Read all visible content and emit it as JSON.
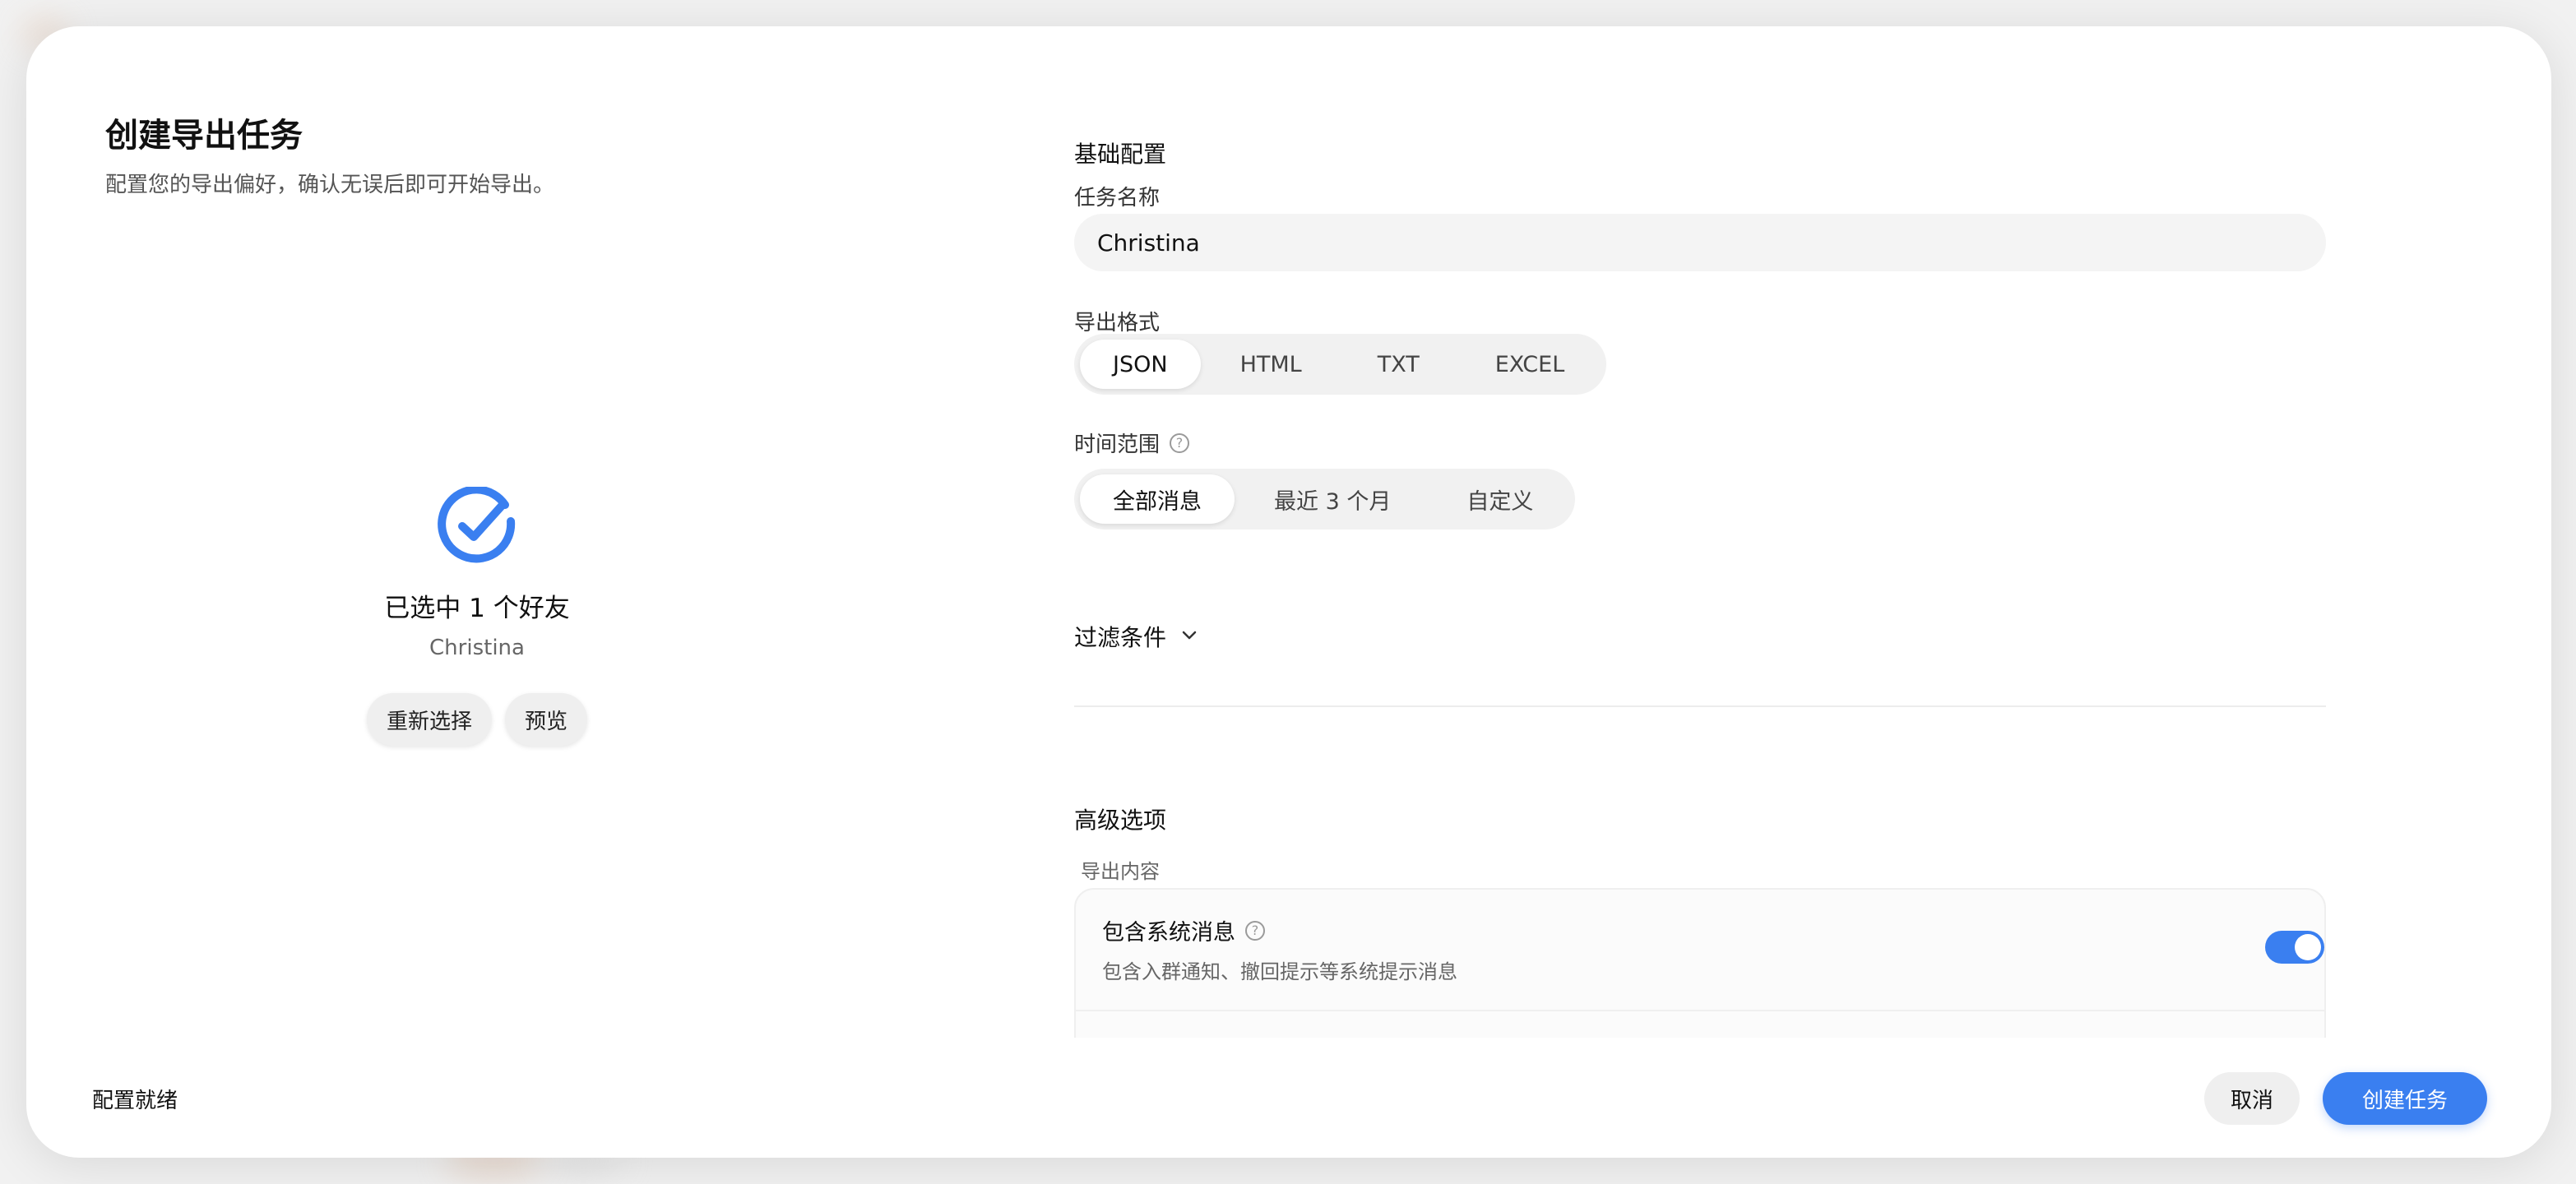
{
  "colors": {
    "accent": "#3a7ff0",
    "modal_bg": "#ffffff",
    "page_bg": "#f1f1f1"
  },
  "dialog": {
    "title": "创建导出任务",
    "subtitle": "配置您的导出偏好，确认无误后即可开始导出。"
  },
  "selection": {
    "icon": "check-circle-icon",
    "title": "已选中 1 个好友",
    "name": "Christina",
    "reselect_label": "重新选择",
    "preview_label": "预览"
  },
  "basic": {
    "section_title": "基础配置",
    "task_name_label": "任务名称",
    "task_name_value": "Christina",
    "format_label": "导出格式",
    "formats": [
      "JSON",
      "HTML",
      "TXT",
      "EXCEL"
    ],
    "format_selected": "JSON",
    "time_label": "时间范围",
    "time_help_icon": "question-circle-icon",
    "time_options": [
      "全部消息",
      "最近 3 个月",
      "自定义"
    ],
    "time_selected": "全部消息",
    "filter_label": "过滤条件",
    "filter_icon": "chevron-down-icon"
  },
  "advanced": {
    "section_title": "高级选项",
    "content_label": "导出内容",
    "options": [
      {
        "title": "包含系统消息",
        "description": "包含入群通知、撤回提示等系统提示消息",
        "enabled": true
      }
    ]
  },
  "footer": {
    "status": "配置就绪",
    "cancel_label": "取消",
    "create_label": "创建任务"
  }
}
